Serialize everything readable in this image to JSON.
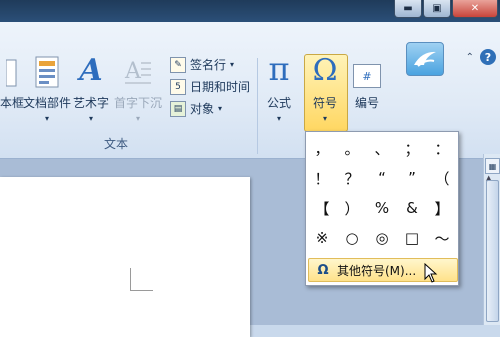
{
  "window": {
    "minimize_glyph": "▬",
    "restore_glyph": "▣",
    "close_glyph": "✕"
  },
  "help": {
    "collapse_glyph": "⌃",
    "help_glyph": "?"
  },
  "ribbon": {
    "text_group_label": "文本",
    "buttons": {
      "textbox_label": "本框",
      "quickparts_label": "文档部件",
      "wordart_label": "艺术字",
      "dropcap_label": "首字下沉",
      "signature_label": "签名行",
      "datetime_label": "日期和时间",
      "object_label": "对象",
      "equation_label": "公式",
      "symbol_label": "符号",
      "number_label": "编号",
      "dropdown_arrow": "▾"
    },
    "glyphs": {
      "pi": "π",
      "omega": "Ω",
      "number_box": "#",
      "wordart": "A"
    }
  },
  "symbol_menu": {
    "symbols": [
      [
        "，",
        "。",
        "、",
        "；",
        "："
      ],
      [
        "！",
        "？",
        "“",
        "”",
        "（"
      ],
      [
        "【",
        "）",
        "%",
        "&",
        "】"
      ],
      [
        "※",
        "○",
        "◎",
        "□",
        "～"
      ]
    ],
    "more_label": "其他符号(M)..."
  },
  "colors": {
    "ribbon_text": "#1e395b",
    "highlight": "#ffd762",
    "title_bar": "#1f3b5a"
  }
}
